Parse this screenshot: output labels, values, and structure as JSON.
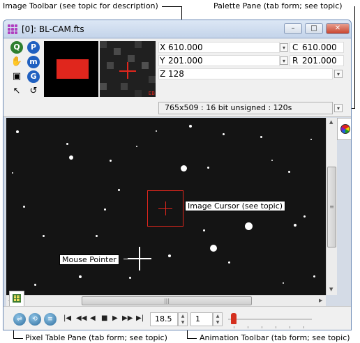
{
  "callouts": {
    "image_toolbar": "Image Toolbar (see topic for description)",
    "palette_pane": "Palette Pane (tab form; see topic)",
    "pixel_table_pane": "Pixel Table Pane (tab form; see topic)",
    "animation_toolbar": "Animation Toolbar (tab form; see topic)",
    "image_cursor": "Image Cursor (see topic)",
    "mouse_pointer": "Mouse Pointer"
  },
  "window": {
    "title": "[0]: BL-CAM.fts",
    "minimize": "–",
    "maximize": "□",
    "close": "✕"
  },
  "toolbar": {
    "buttons": [
      {
        "label": "Q",
        "icon": "zoom-icon",
        "color": "#2f7f2f"
      },
      {
        "label": "P",
        "icon": "p-icon",
        "color": "#2060c0"
      },
      {
        "label": "✋",
        "icon": "pan-hand-icon",
        "color": "#444444"
      },
      {
        "label": "m",
        "icon": "m-icon",
        "color": "#2060c0"
      },
      {
        "label": "▣",
        "icon": "rectangle-select-icon",
        "color": "#444444"
      },
      {
        "label": "G",
        "icon": "g-icon",
        "color": "#2060c0"
      },
      {
        "label": "↖",
        "icon": "arrow-pointer-icon",
        "color": "#000000"
      },
      {
        "label": "↺",
        "icon": "refresh-icon",
        "color": "#444444"
      }
    ],
    "x_label": "X",
    "x_value": "610.000",
    "c_label": "C",
    "c_value": "610.000",
    "y_label": "Y",
    "y_value": "201.000",
    "r_label": "R",
    "r_value": "201.000",
    "z_label": "Z",
    "z_value": "128",
    "info": "765x509 : 16 bit unsigned : 120s",
    "mag_marker": "EB"
  },
  "animation": {
    "rate": "18.5",
    "step": "1"
  },
  "colors": {
    "cursor": "#e0261d",
    "sky": "#141414"
  }
}
